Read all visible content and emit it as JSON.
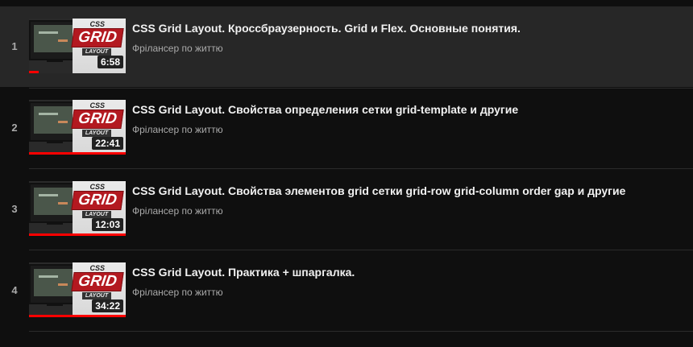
{
  "playlist": {
    "items": [
      {
        "index": "1",
        "title": "CSS Grid Layout. Кроссбраузерность. Grid и Flex. Основные понятия.",
        "channel": "Фрілансер по життю",
        "duration": "6:58",
        "thumb_text": "GRID",
        "thumb_css": "CSS",
        "thumb_layout": "LAYOUT",
        "watch_progress": 0.1,
        "active": true
      },
      {
        "index": "2",
        "title": "CSS Grid Layout. Свойства определения сетки grid-template и другие",
        "channel": "Фрілансер по життю",
        "duration": "22:41",
        "thumb_text": "GRID",
        "thumb_css": "CSS",
        "thumb_layout": "LAYOUT",
        "watch_progress": 1.0,
        "active": false
      },
      {
        "index": "3",
        "title": "CSS Grid Layout. Свойства элементов grid сетки grid-row grid-column order gap и другие",
        "channel": "Фрілансер по життю",
        "duration": "12:03",
        "thumb_text": "GRID",
        "thumb_css": "CSS",
        "thumb_layout": "LAYOUT",
        "watch_progress": 1.0,
        "active": false
      },
      {
        "index": "4",
        "title": "CSS Grid Layout. Практика + шпаргалка.",
        "channel": "Фрілансер по життю",
        "duration": "34:22",
        "thumb_text": "GRID",
        "thumb_css": "CSS",
        "thumb_layout": "LAYOUT",
        "watch_progress": 1.0,
        "active": false
      }
    ]
  },
  "colors": {
    "background": "#0f0f0f",
    "active_row": "#272727",
    "progress": "#ff0000",
    "title": "#f1f1f1",
    "secondary": "#aaaaaa"
  }
}
